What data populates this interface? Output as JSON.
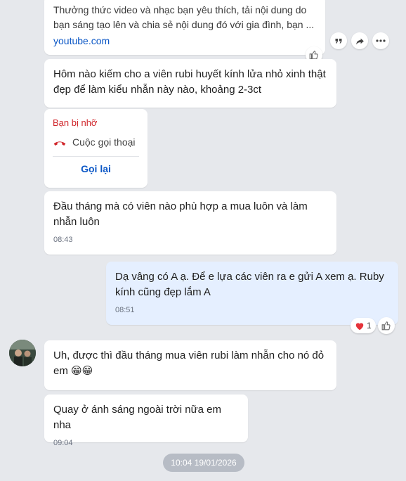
{
  "link_card": {
    "description": "Thưởng thức video và nhạc bạn yêu thích, tải nội dung do bạn sáng tạo lên và chia sẻ nội dung đó với gia đình, bạn ...",
    "domain": "youtube.com"
  },
  "messages": {
    "m1": {
      "text": "Hôm nào kiếm cho a viên rubi huyết kính lửa nhỏ xinh thật đẹp để làm kiểu nhẫn này nào, khoảng 2-3ct"
    },
    "call": {
      "title": "Bạn bị nhỡ",
      "type_label": "Cuộc gọi thoại",
      "callback_label": "Gọi lại"
    },
    "m2": {
      "text": "Đầu tháng mà có viên nào phù hợp a mua luôn và làm nhẫn luôn",
      "time": "08:43"
    },
    "m3": {
      "text": "Dạ vâng có A ạ. Để e lựa các viên ra e gửi A xem ạ. Ruby kính cũng đẹp lắm A",
      "time": "08:51",
      "reaction_count": "1"
    },
    "m4": {
      "text": "Uh, được thì đầu tháng mua viên rubi làm nhẫn cho nó đỏ em 😁😁"
    },
    "m5": {
      "text": "Quay ở ánh sáng ngoài trời nữa em nha",
      "time": "09:04"
    }
  },
  "date_separator": "10:04 19/01/2026",
  "icons": {
    "quote": "quote-icon",
    "share": "share-icon",
    "more": "more-icon",
    "like": "thumbs-up-icon",
    "heart": "heart-icon",
    "missed_call": "missed-call-icon"
  },
  "colors": {
    "background": "#e6e8ec",
    "own_bubble": "#e5efff",
    "link": "#0b57c6",
    "missed": "#d0262b"
  }
}
